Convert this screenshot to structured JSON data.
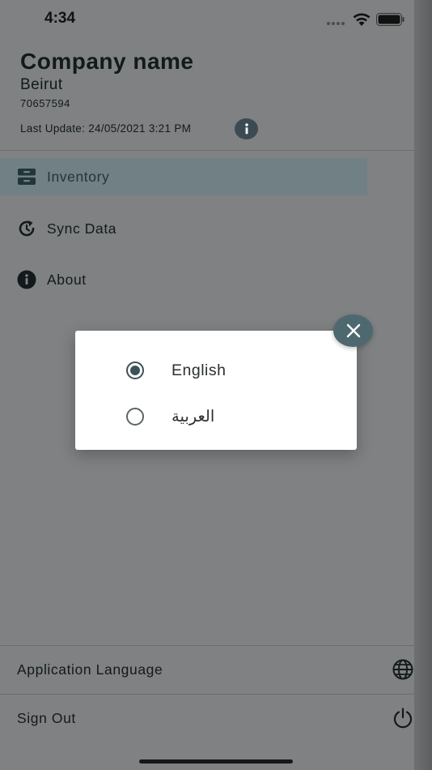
{
  "status_bar": {
    "time": "4:34"
  },
  "header": {
    "company_name": "Company name",
    "city": "Beirut",
    "phone": "70657594",
    "last_update": "Last Update: 24/05/2021 3:21 PM"
  },
  "nav": {
    "items": [
      {
        "label": "Inventory",
        "icon": "inventory-icon",
        "active": true
      },
      {
        "label": "Sync Data",
        "icon": "sync-icon",
        "active": false
      },
      {
        "label": "About",
        "icon": "info-icon",
        "active": false
      }
    ]
  },
  "bottom": {
    "language_label": "Application Language",
    "signout_label": "Sign Out"
  },
  "dialog": {
    "options": [
      {
        "label": "English",
        "selected": true
      },
      {
        "label": "العربية",
        "selected": false
      }
    ]
  },
  "colors": {
    "overlay": "#7f8182",
    "accent": "#3f5158",
    "close_button": "#4e6870"
  }
}
